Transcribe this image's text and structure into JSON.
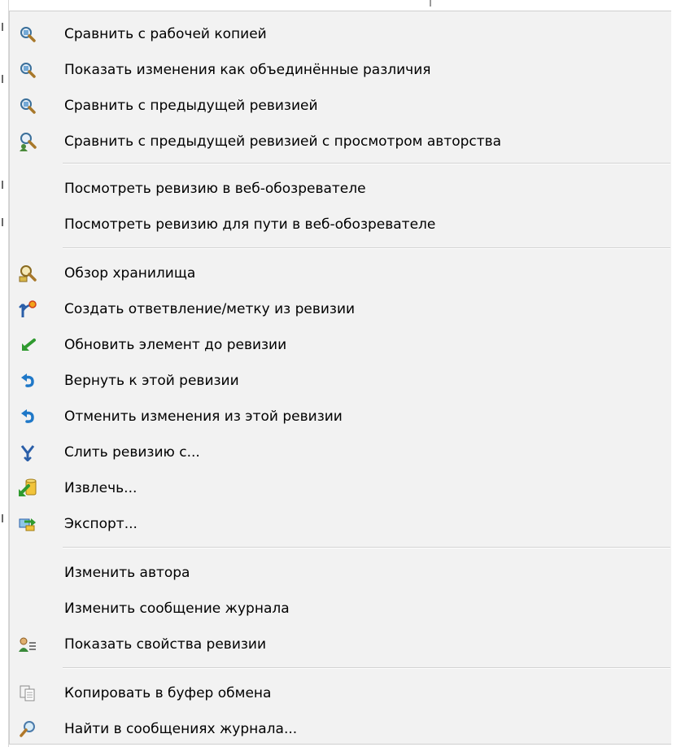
{
  "menu": {
    "items": [
      {
        "label": "Сравнить с рабочей копией",
        "icon": "magnifier-icon"
      },
      {
        "label": "Показать изменения как объединённые различия",
        "icon": "magnifier-icon"
      },
      {
        "label": "Сравнить с предыдущей ревизией",
        "icon": "magnifier-icon"
      },
      {
        "label": "Сравнить с предыдущей ревизией с просмотром авторства",
        "icon": "blame-icon"
      },
      {
        "label": "Посмотреть ревизию в веб-обозревателе",
        "icon": ""
      },
      {
        "label": "Посмотреть ревизию для пути в веб-обозревателе",
        "icon": ""
      },
      {
        "label": "Обзор хранилища",
        "icon": "repo-browser-icon"
      },
      {
        "label": "Создать ответвление/метку из ревизии",
        "icon": "branch-icon"
      },
      {
        "label": "Обновить элемент до ревизии",
        "icon": "update-arrow-icon"
      },
      {
        "label": "Вернуть к этой ревизии",
        "icon": "revert-icon"
      },
      {
        "label": "Отменить изменения из этой ревизии",
        "icon": "revert-icon"
      },
      {
        "label": "Слить ревизию с...",
        "icon": "merge-icon"
      },
      {
        "label": "Извлечь...",
        "icon": "checkout-icon"
      },
      {
        "label": "Экспорт...",
        "icon": "export-icon"
      },
      {
        "label": "Изменить автора",
        "icon": ""
      },
      {
        "label": "Изменить сообщение журнала",
        "icon": ""
      },
      {
        "label": "Показать свойства ревизии",
        "icon": "properties-icon"
      },
      {
        "label": "Копировать в буфер обмена",
        "icon": "copy-icon"
      },
      {
        "label": "Найти в сообщениях журнала...",
        "icon": "search-icon"
      }
    ]
  },
  "colors": {
    "menu_bg": "#f2f2f2",
    "separator": "#d3d3d3",
    "text": "#000000"
  }
}
